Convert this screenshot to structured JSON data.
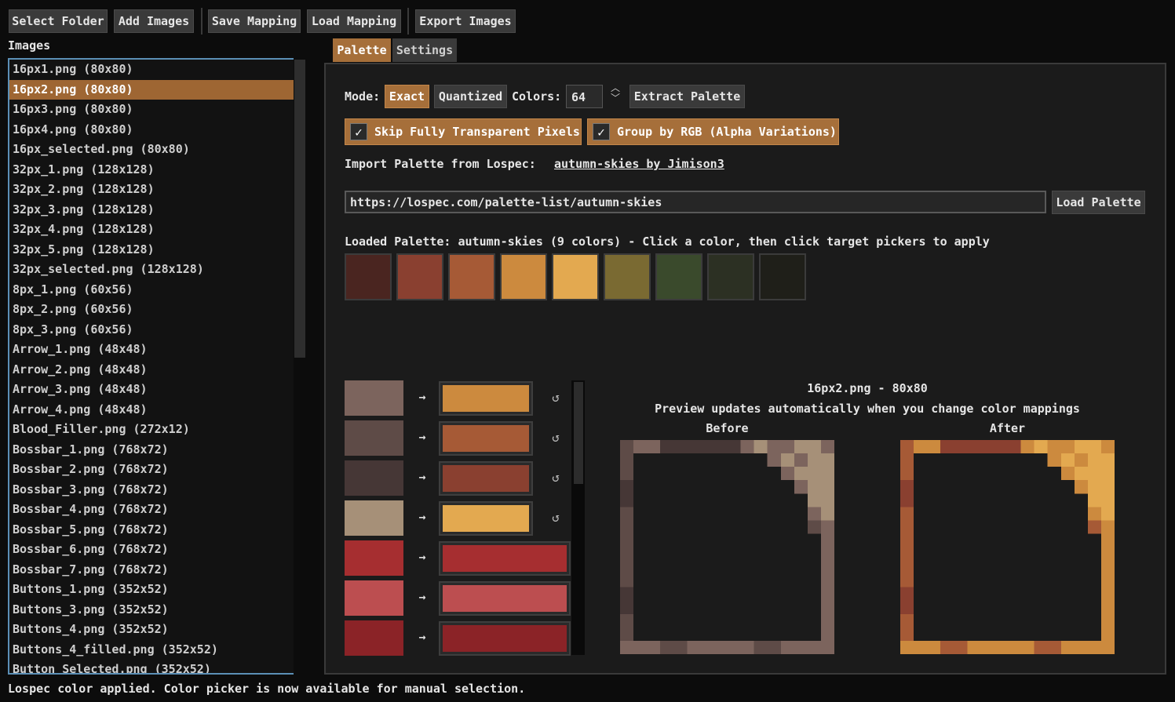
{
  "toolbar": {
    "select_folder": "Select Folder",
    "add_images": "Add Images",
    "save_mapping": "Save Mapping",
    "load_mapping": "Load Mapping",
    "export_images": "Export Images"
  },
  "images_header": "Images",
  "images": [
    "16px1.png (80x80)",
    "16px2.png (80x80)",
    "16px3.png (80x80)",
    "16px4.png (80x80)",
    "16px_selected.png (80x80)",
    "32px_1.png (128x128)",
    "32px_2.png (128x128)",
    "32px_3.png (128x128)",
    "32px_4.png (128x128)",
    "32px_5.png (128x128)",
    "32px_selected.png (128x128)",
    "8px_1.png (60x56)",
    "8px_2.png (60x56)",
    "8px_3.png (60x56)",
    "Arrow_1.png (48x48)",
    "Arrow_2.png (48x48)",
    "Arrow_3.png (48x48)",
    "Arrow_4.png (48x48)",
    "Blood_Filler.png (272x12)",
    "Bossbar_1.png (768x72)",
    "Bossbar_2.png (768x72)",
    "Bossbar_3.png (768x72)",
    "Bossbar_4.png (768x72)",
    "Bossbar_5.png (768x72)",
    "Bossbar_6.png (768x72)",
    "Bossbar_7.png (768x72)",
    "Buttons_1.png (352x52)",
    "Buttons_3.png (352x52)",
    "Buttons_4.png (352x52)",
    "Buttons_4_filled.png (352x52)",
    "Button_Selected.png (352x52)"
  ],
  "selected_image_index": 1,
  "tabs": {
    "palette": "Palette",
    "settings": "Settings",
    "active": "palette"
  },
  "mode": {
    "label": "Mode:",
    "exact": "Exact",
    "quantized": "Quantized",
    "active": "exact",
    "colors_label": "Colors:",
    "colors_value": "64",
    "extract_button": "Extract Palette"
  },
  "options": {
    "skip_transparent": {
      "label": "Skip Fully Transparent Pixels",
      "checked": true
    },
    "group_by_rgb": {
      "label": "Group by RGB (Alpha Variations)",
      "checked": true
    }
  },
  "lospec": {
    "import_label": "Import Palette from Lospec:",
    "link_text": "autumn-skies by Jimison3",
    "url_value": "https://lospec.com/palette-list/autumn-skies",
    "load_button": "Load Palette",
    "loaded_text": "Loaded Palette: autumn-skies (9 colors) - Click a color, then click target pickers to apply"
  },
  "palette_colors": [
    "#4a2520",
    "#8a4030",
    "#a65a36",
    "#cc8a3e",
    "#e3a950",
    "#7a6a32",
    "#3a4a2c",
    "#2c3023",
    "#1f1f19"
  ],
  "mappings": [
    {
      "source": "#7c645d",
      "target": "#cc8a3e",
      "reset": true
    },
    {
      "source": "#5e4b47",
      "target": "#a65a36",
      "reset": true
    },
    {
      "source": "#463736",
      "target": "#8a4030",
      "reset": true
    },
    {
      "source": "#a69078",
      "target": "#e3a950",
      "reset": true
    },
    {
      "source": "#a62e30",
      "target": "#a62e30",
      "reset": false
    },
    {
      "source": "#bc4e50",
      "target": "#bc4e50",
      "reset": false
    },
    {
      "source": "#8b2327",
      "target": "#8b2327",
      "reset": false
    }
  ],
  "mapping_arrow": "→",
  "reset_icon_glyph": "↺",
  "preview": {
    "title": "16px2.png - 80x80",
    "subtitle": "Preview updates automatically when you change color mappings",
    "before_label": "Before",
    "after_label": "After"
  },
  "status": "Lospec color applied. Color picker is now available for manual selection."
}
